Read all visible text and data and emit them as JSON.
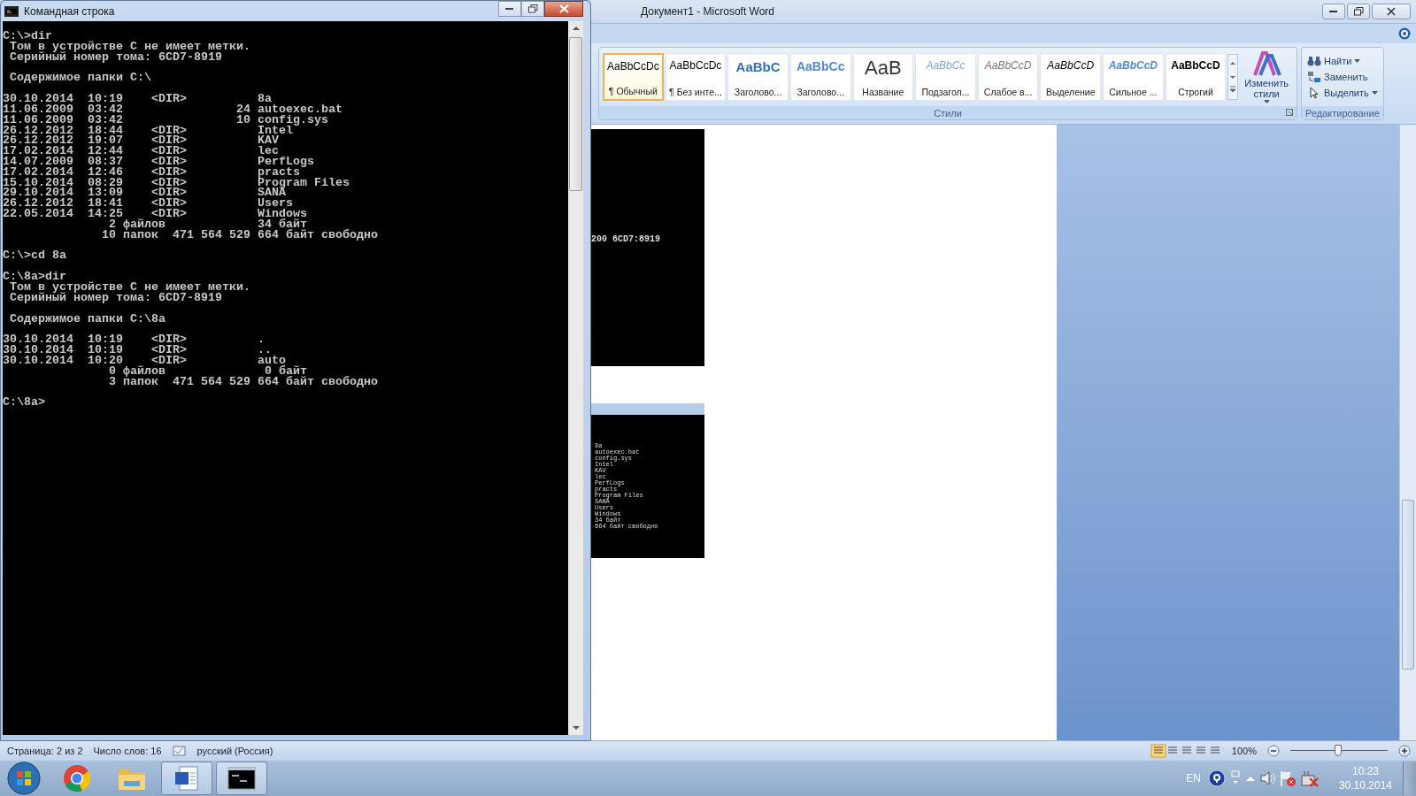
{
  "cmd_window": {
    "title": "Командная строка",
    "blocks": [
      [
        "C:\\>dir",
        " Том в устройстве C не имеет метки.",
        " Серийный номер тома: 6CD7-8919"
      ],
      [
        " Содержимое папки C:\\"
      ],
      [
        "30.10.2014  10:19    <DIR>          8a",
        "11.06.2009  03:42                24 autoexec.bat",
        "11.06.2009  03:42                10 config.sys",
        "26.12.2012  18:44    <DIR>          Intel",
        "26.12.2012  19:07    <DIR>          KAV",
        "17.02.2014  12:44    <DIR>          lec",
        "14.07.2009  08:37    <DIR>          PerfLogs",
        "17.02.2014  12:46    <DIR>          practs",
        "15.10.2014  08:29    <DIR>          Program Files",
        "29.10.2014  13:09    <DIR>          SANA",
        "26.12.2012  18:41    <DIR>          Users",
        "22.05.2014  14:25    <DIR>          Windows",
        "               2 файлов             34 байт",
        "              10 папок  471 564 529 664 байт свободно"
      ],
      [
        "C:\\>cd 8a"
      ],
      [
        "C:\\8a>dir",
        " Том в устройстве C не имеет метки.",
        " Серийный номер тома: 6CD7-8919"
      ],
      [
        " Содержимое папки C:\\8a"
      ],
      [
        "30.10.2014  10:19    <DIR>          .",
        "30.10.2014  10:19    <DIR>          ..",
        "30.10.2014  10:20    <DIR>          auto",
        "               0 файлов              0 байт",
        "               3 папок  471 564 529 664 байт свободно"
      ],
      [
        "C:\\8a>"
      ]
    ]
  },
  "word_window": {
    "title": "Документ1 - Microsoft Word",
    "styles": [
      {
        "kind": "normal",
        "sample": "AaBbCcDc",
        "label": "¶ Обычный",
        "selected": true
      },
      {
        "kind": "normal",
        "sample": "AaBbCcDc",
        "label": "¶ Без инте...",
        "selected": false
      },
      {
        "kind": "heading1",
        "sample": "AaBbC",
        "label": "Заголово...",
        "selected": false
      },
      {
        "kind": "heading2",
        "sample": "AaBbCc",
        "label": "Заголово...",
        "selected": false
      },
      {
        "kind": "title",
        "sample": "AaB",
        "label": "Название",
        "selected": false
      },
      {
        "kind": "subtitle",
        "sample": "AaBbCc",
        "label": "Подзагол...",
        "selected": false
      },
      {
        "kind": "subtle",
        "sample": "AaBbCcD",
        "label": "Слабое в...",
        "selected": false
      },
      {
        "kind": "emphasis",
        "sample": "AaBbCcD",
        "label": "Выделение",
        "selected": false
      },
      {
        "kind": "intense",
        "sample": "AaBbCcD",
        "label": "Сильное ...",
        "selected": false
      },
      {
        "kind": "strong",
        "sample": "AaBbCcD",
        "label": "Строгий",
        "selected": false
      }
    ],
    "styles_group": "Стили",
    "change_styles": "Изменить стили",
    "editing": [
      {
        "kind": "find",
        "label": "Найти",
        "dropdown": true
      },
      {
        "kind": "replace",
        "label": "Заменить",
        "dropdown": false
      },
      {
        "kind": "select",
        "label": "Выделить",
        "dropdown": true
      }
    ],
    "editing_group": "Редактирование",
    "document": {
      "screenshot_1": {
        "text": "200 6CD7:8919"
      },
      "screenshot_2": {
        "lines": [
          "8a",
          "autoexec.bat",
          "config.sys",
          "Intel",
          "KAV",
          "lec",
          "PerfLogs",
          "practs",
          "Program Files",
          "SANA",
          "Users",
          "Windows",
          "34 байт",
          "664 байт свободно"
        ]
      }
    },
    "status_bar": {
      "page": "Страница: 2 из 2",
      "words": "Число слов: 16",
      "language": "русский (Россия)",
      "zoom": "100%",
      "level": 0.49
    }
  },
  "taskbar": {
    "items": [
      {
        "kind": "browser",
        "running": false
      },
      {
        "kind": "folder",
        "running": false
      },
      {
        "kind": "word",
        "running": true
      },
      {
        "kind": "console",
        "running": true
      }
    ],
    "language": "EN",
    "time": "10:23",
    "date": "30.10.2014"
  }
}
